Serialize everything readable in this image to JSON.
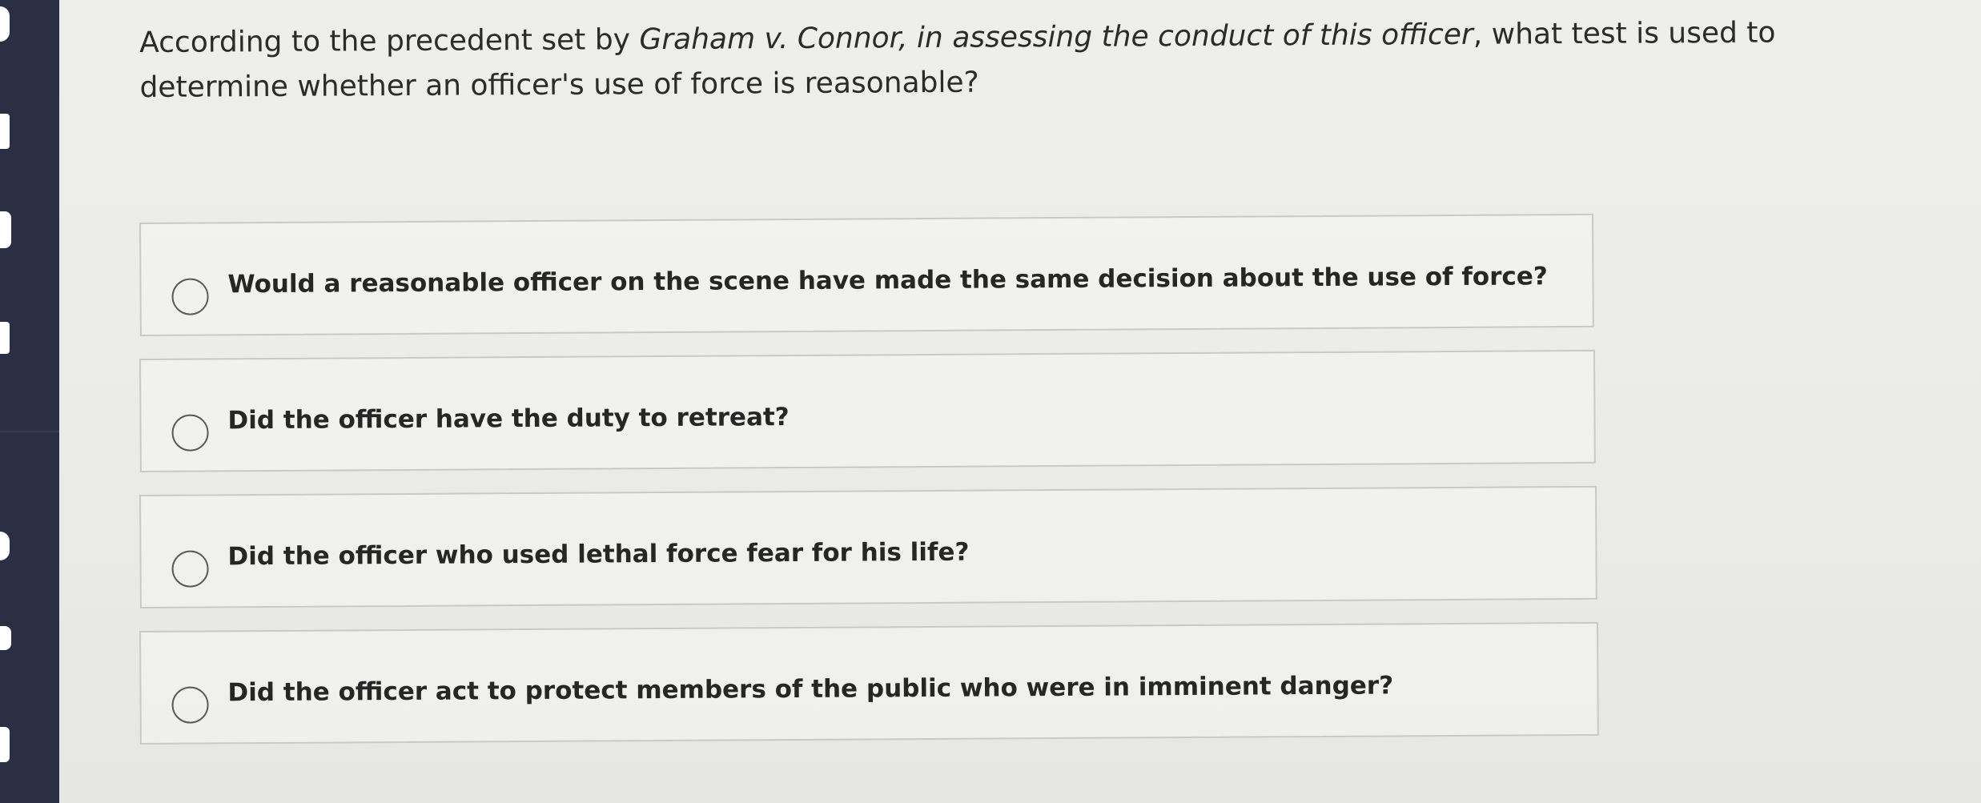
{
  "question": {
    "part1": "According to the precedent set by ",
    "italic": "Graham v. Connor, in assessing the conduct of this officer",
    "part2": ", what test is used to determine whether an officer's use of force is reasonable?"
  },
  "options": [
    {
      "label": "Would a reasonable officer on the scene have made the same decision about the use of force?",
      "selected": false
    },
    {
      "label": "Did the officer have the duty to retreat?",
      "selected": false
    },
    {
      "label": "Did the officer who used lethal force fear for his life?",
      "selected": false
    },
    {
      "label": "Did the officer act to protect members of the public who were in imminent danger?",
      "selected": false
    }
  ],
  "colors": {
    "sidebar": "#2a2f44",
    "background": "#ecece8",
    "option_border": "#c9c9c5",
    "text": "#262626"
  },
  "icons": [
    "radio-button-icon"
  ]
}
